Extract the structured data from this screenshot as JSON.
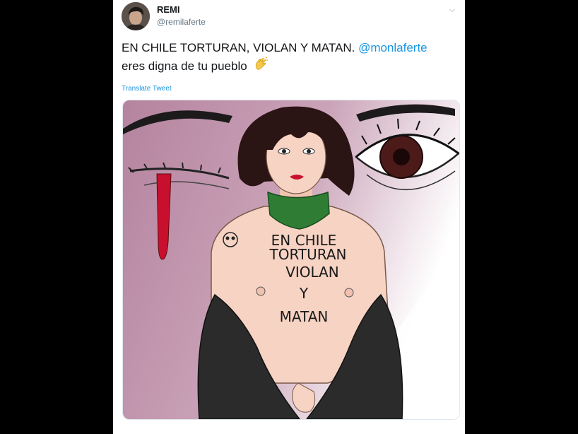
{
  "tweet": {
    "author_name": "REMI",
    "author_handle": "@remilaferte",
    "text_main": "EN CHILE TORTURAN, VIOLAN Y MATAN.",
    "mention": "@monlaferte",
    "text_rest": "eres digna de tu pueblo",
    "emoji": "clapping-hands",
    "translate_label": "Translate Tweet"
  },
  "illustration": {
    "body_text": [
      "EN CHILE",
      "TORTURAN",
      "VIOLAN",
      "Y",
      "MATAN"
    ]
  },
  "colors": {
    "link": "#1b95e0",
    "background_mauve": "#b88aa3",
    "scarf_green": "#2f7d35",
    "blood_red": "#c8102e",
    "jacket": "#2b2b2b"
  }
}
